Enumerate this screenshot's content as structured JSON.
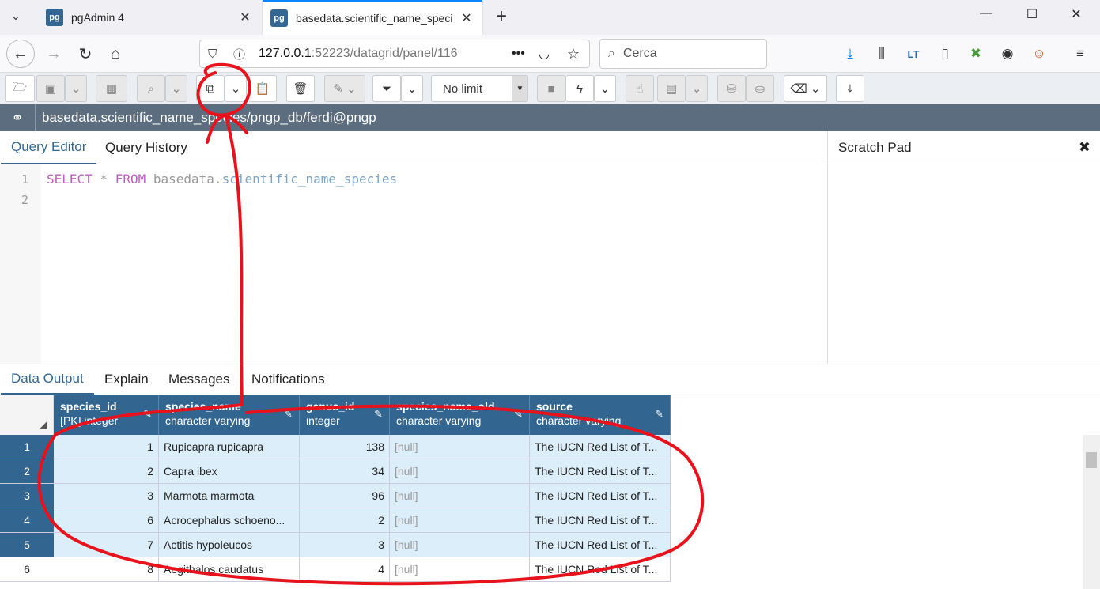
{
  "browser": {
    "tabs": [
      {
        "title": "pgAdmin 4",
        "logo": "pg"
      },
      {
        "title": "basedata.scientific_name_speci",
        "logo": "pg"
      }
    ],
    "url_main": "127.0.0.1",
    "url_rest": ":52223/datagrid/panel/116",
    "search_placeholder": "Cerca"
  },
  "toolbar": {
    "limit_value": "No limit"
  },
  "connection": {
    "label": "basedata.scientific_name_species/pngp_db/ferdi@pngp"
  },
  "editor": {
    "tabs": [
      "Query Editor",
      "Query History"
    ],
    "active_tab": "Query Editor",
    "line_numbers": [
      "1",
      "2"
    ],
    "sql": {
      "select": "SELECT",
      "star": " * ",
      "from": "FROM",
      "schema": " basedata.",
      "table": "scientific_name_species"
    }
  },
  "scratch_pad": {
    "title": "Scratch Pad",
    "close": "✖"
  },
  "output": {
    "tabs": [
      "Data Output",
      "Explain",
      "Messages",
      "Notifications"
    ],
    "active_tab": "Data Output"
  },
  "grid": {
    "columns": [
      {
        "name": "species_id",
        "type": "[PK] integer"
      },
      {
        "name": "species_name",
        "type": "character varying"
      },
      {
        "name": "genus_id",
        "type": "integer"
      },
      {
        "name": "species_name_old",
        "type": "character varying"
      },
      {
        "name": "source",
        "type": "character varying"
      }
    ],
    "rows": [
      {
        "n": "1",
        "species_id": "1",
        "species_name": "Rupicapra rupicapra",
        "genus_id": "138",
        "species_name_old": "[null]",
        "source": "The IUCN Red List of T..."
      },
      {
        "n": "2",
        "species_id": "2",
        "species_name": "Capra ibex",
        "genus_id": "34",
        "species_name_old": "[null]",
        "source": "The IUCN Red List of T..."
      },
      {
        "n": "3",
        "species_id": "3",
        "species_name": "Marmota marmota",
        "genus_id": "96",
        "species_name_old": "[null]",
        "source": "The IUCN Red List of T..."
      },
      {
        "n": "4",
        "species_id": "6",
        "species_name": "Acrocephalus schoeno...",
        "genus_id": "2",
        "species_name_old": "[null]",
        "source": "The IUCN Red List of T..."
      },
      {
        "n": "5",
        "species_id": "7",
        "species_name": "Actitis hypoleucos",
        "genus_id": "3",
        "species_name_old": "[null]",
        "source": "The IUCN Red List of T..."
      },
      {
        "n": "6",
        "species_id": "8",
        "species_name": "Aegithalos caudatus",
        "genus_id": "4",
        "species_name_old": "[null]",
        "source": "The IUCN Red List of T..."
      }
    ],
    "selected_rows": 5
  },
  "colors": {
    "accent": "#326690",
    "connection_bar": "#5b6d7f",
    "selected_cell": "#dbeef9",
    "annotation": "#e8121c"
  }
}
